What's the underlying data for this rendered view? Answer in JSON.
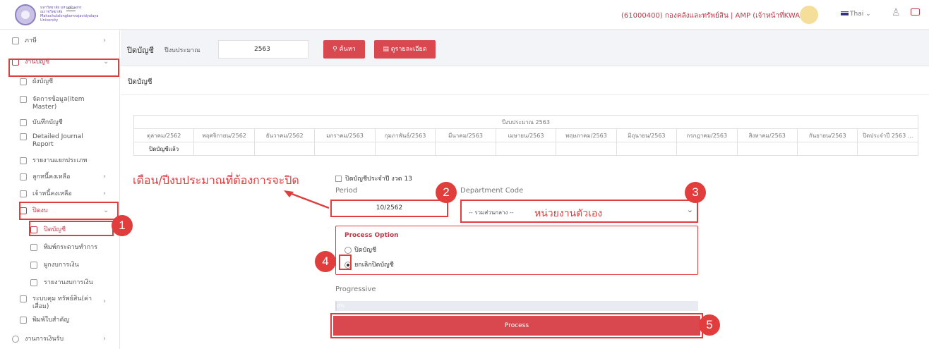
{
  "header": {
    "university_name": "มหาวิทยาลัย มหาจุฬาลงกรณราชวิทยาลัย Mahachulalongkornrajavidyalaya University",
    "user_info": "(61000400) กองคลังและทรัพย์สิน | AMP (เจ้าหน้าที่KWANP)",
    "language": "Thai",
    "icons": [
      "university-logo-icon",
      "menu-icon",
      "avatar",
      "flag-icon",
      "bell-icon",
      "chat-icon"
    ]
  },
  "sidebar": {
    "items": [
      {
        "label": "ภาษี"
      },
      {
        "label": "งานบัญชี"
      },
      {
        "label": "ผังบัญชี"
      },
      {
        "label": "จัดการข้อมูล(Item Master)"
      },
      {
        "label": "บันทึกบัญชี"
      },
      {
        "label": "Detailed Journal Report"
      },
      {
        "label": "รายงานแยกประเภท"
      },
      {
        "label": "ลูกหนี้คงเหลือ"
      },
      {
        "label": "เจ้าหนี้คงเหลือ"
      },
      {
        "label": "ปิดงบ"
      },
      {
        "label": "ปิดบัญชี"
      },
      {
        "label": "พิมพ์กระดาษทำการ"
      },
      {
        "label": "ผูกงบการเงิน"
      },
      {
        "label": "รายงานงบการเงิน"
      },
      {
        "label": "ระบบคุม ทรัพย์สิน(ค่าเสื่อม)"
      },
      {
        "label": "พิมพ์ใบสำคัญ"
      },
      {
        "label": "งานการเงินรับ"
      }
    ]
  },
  "toolbar": {
    "page_title": "ปิดบัญชี",
    "fiscal_year_label": "ปีงบประมาณ",
    "fiscal_year_value": "2563",
    "search_label": "ค้นหา",
    "detail_label": "ดูรายละเอียด"
  },
  "card": {
    "title": "ปิดบัญชี"
  },
  "months_table": {
    "header": "ปีงบประมาณ 2563",
    "months": [
      "ตุลาคม/2562",
      "พฤศจิกายน/2562",
      "ธันวาคม/2562",
      "มกราคม/2563",
      "กุมภาพันธ์/2563",
      "มีนาคม/2563",
      "เมษายน/2563",
      "พฤษภาคม/2563",
      "มิถุนายน/2563",
      "กรกฎาคม/2563",
      "สิงหาคม/2563",
      "กันยายน/2563",
      "ปิดประจำปี 2563 ..."
    ],
    "status": [
      "ปิดบัญชีแล้ว",
      "",
      "",
      "",
      "",
      "",
      "",
      "",
      "",
      "",
      "",
      "",
      ""
    ]
  },
  "form": {
    "annual_close_checkbox": "ปิดบัญชีประจำปี งวด 13",
    "hint": "เดือน/ปีงบประมาณที่ต้องการจะปิด",
    "period_label": "Period",
    "period_value": "10/2562",
    "dept_label": "Department Code",
    "dept_value": "-- รวมส่วนกลาง --",
    "dept_note": "หน่วยงานตัวเอง",
    "process_option_title": "Process Option",
    "option_close": "ปิดบัญชี",
    "option_cancel": "ยกเลิกปิดบัญชี",
    "selected_option": "ยกเลิกปิดบัญชี",
    "progressive_label": "Progressive",
    "progress_percent": 0,
    "progress_text": "0%",
    "process_button": "Process"
  },
  "annotations": [
    "1",
    "2",
    "3",
    "4",
    "5"
  ],
  "colors": {
    "accent": "#d9474f",
    "annotation": "#e23d3d"
  }
}
